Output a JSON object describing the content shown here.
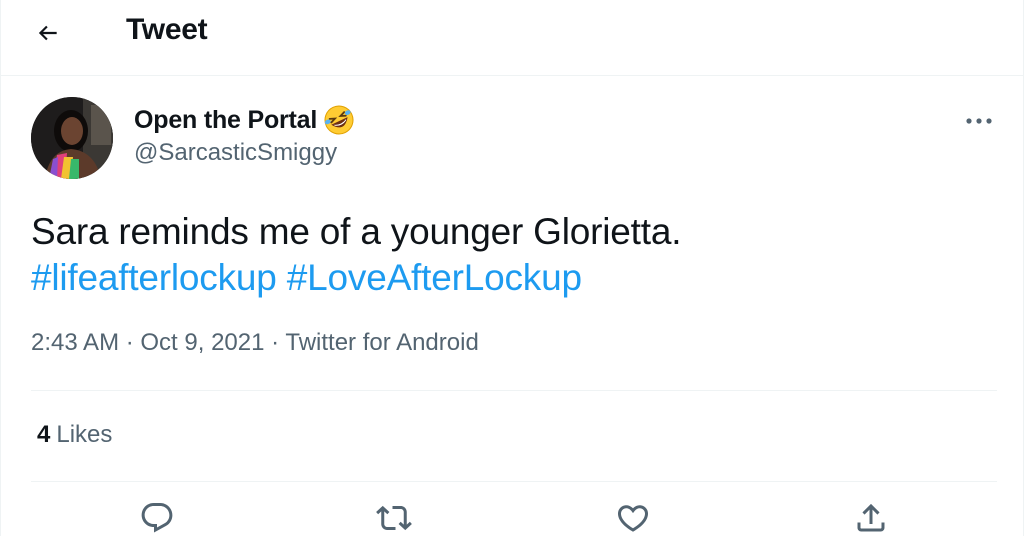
{
  "header": {
    "title": "Tweet",
    "back_icon": "arrow-left-icon"
  },
  "author": {
    "display_name": "Open the Portal",
    "name_emoji": "rolling-on-floor-laughing-emoji",
    "handle": "@SarcasticSmiggy",
    "avatar": "avatar-photo"
  },
  "tweet": {
    "text": "Sara reminds me of a younger Glorietta.",
    "hashtags": [
      "#lifeafterlockup",
      "#LoveAfterLockup"
    ]
  },
  "meta": {
    "time": "2:43 AM",
    "separator": " · ",
    "date": "Oct 9, 2021",
    "source": "Twitter for Android"
  },
  "stats": {
    "likes_count": "4",
    "likes_label": "Likes"
  },
  "actions": [
    "reply-icon",
    "retweet-icon",
    "like-icon",
    "share-icon"
  ],
  "colors": {
    "link": "#1d9bf0",
    "secondary_text": "#536471",
    "primary_text": "#0f1419",
    "border": "#eff3f4"
  }
}
